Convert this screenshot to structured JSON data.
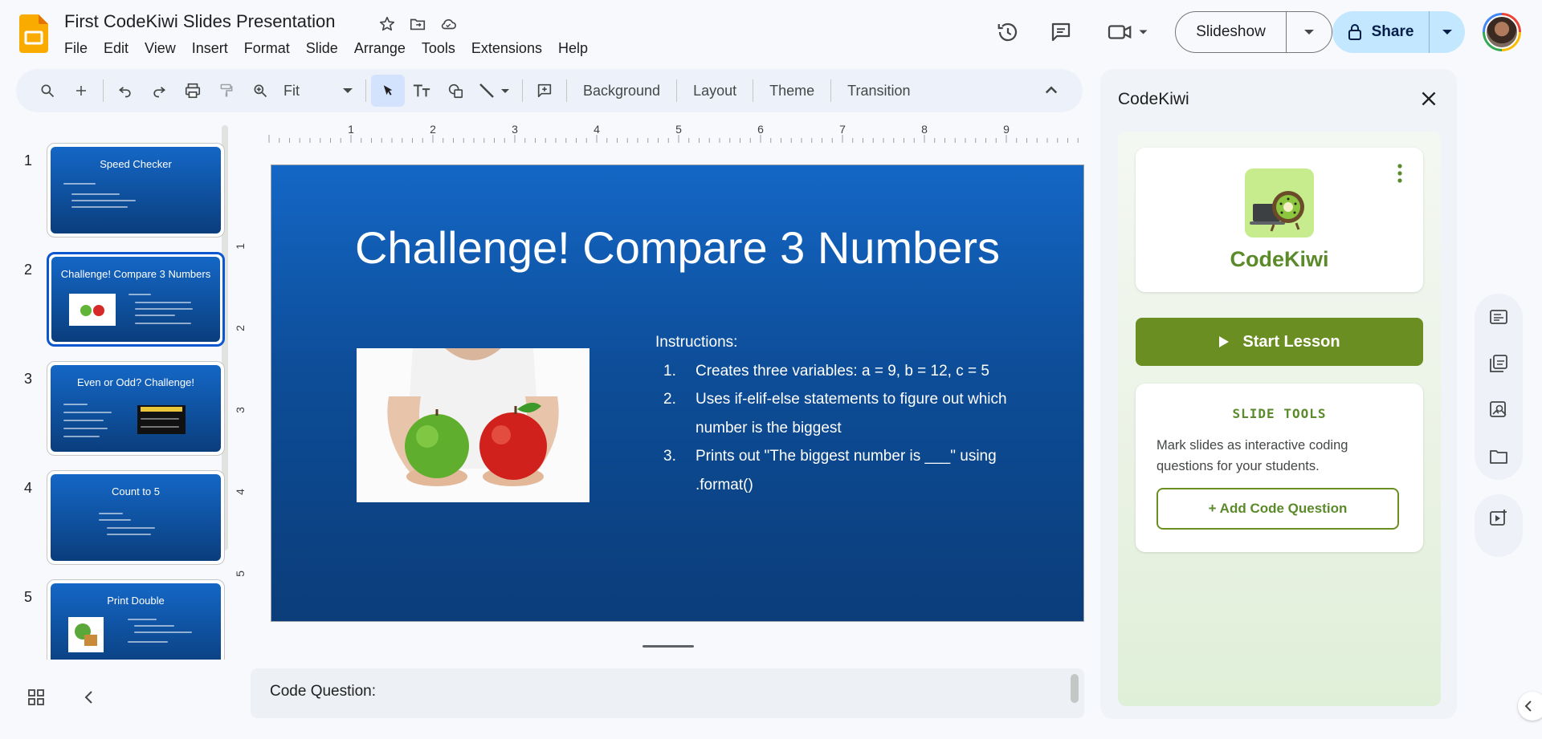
{
  "app": {
    "name": "Google Slides",
    "accent": "#0b57d0",
    "logo_color": "#f9ab00"
  },
  "document": {
    "title": "First CodeKiwi Slides Presentation"
  },
  "menu": [
    "File",
    "Edit",
    "View",
    "Insert",
    "Format",
    "Slide",
    "Arrange",
    "Tools",
    "Extensions",
    "Help"
  ],
  "header": {
    "slideshow_label": "Slideshow",
    "share_label": "Share"
  },
  "toolbar": {
    "zoom_value": "Fit",
    "background_label": "Background",
    "layout_label": "Layout",
    "theme_label": "Theme",
    "transition_label": "Transition"
  },
  "filmstrip": [
    {
      "number": "1",
      "title": "Speed Checker"
    },
    {
      "number": "2",
      "title": "Challenge! Compare 3 Numbers",
      "selected": true
    },
    {
      "number": "3",
      "title": "Even or Odd?  Challenge!"
    },
    {
      "number": "4",
      "title": "Count to 5"
    },
    {
      "number": "5",
      "title": "Print Double"
    }
  ],
  "ruler": {
    "horizontal": [
      "1",
      "2",
      "3",
      "4",
      "5",
      "6",
      "7",
      "8",
      "9"
    ],
    "vertical": [
      "1",
      "2",
      "3",
      "4",
      "5"
    ]
  },
  "slide": {
    "title": "Challenge! Compare 3 Numbers",
    "instructions_heading": "Instructions:",
    "instructions": [
      {
        "n": "1.",
        "text": "Creates three variables: a = 9, b = 12, c = 5"
      },
      {
        "n": "2.",
        "text": "Uses if-elif-else statements to figure out which number is the biggest"
      },
      {
        "n": "3.",
        "text": "Prints out \"The biggest number is ___\" using .format()"
      }
    ],
    "image": "hands-holding-green-and-red-apples"
  },
  "notes": {
    "text": "Code Question:"
  },
  "codekiwi": {
    "panel_title": "CodeKiwi",
    "brand_name": "CodeKiwi",
    "start_lesson_label": "Start Lesson",
    "slide_tools_heading": "SLIDE TOOLS",
    "slide_tools_desc": "Mark slides as interactive coding questions for your students.",
    "add_question_label": "+  Add Code Question",
    "brand_color": "#5b8a2a",
    "button_color": "#6b8e23"
  }
}
